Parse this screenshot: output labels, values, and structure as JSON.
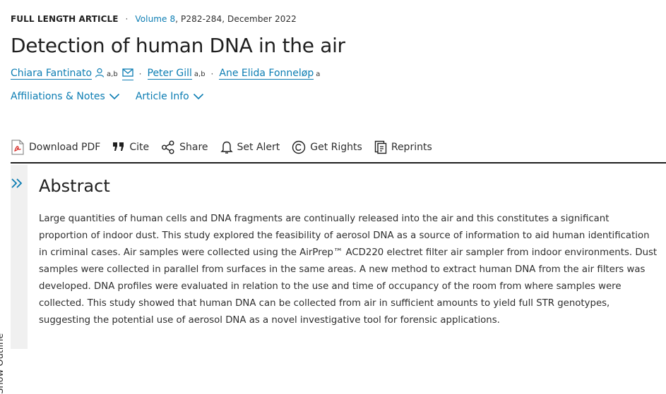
{
  "article": {
    "type": "FULL LENGTH ARTICLE",
    "volume": "Volume 8",
    "pages_date": ", P282-284, December 2022",
    "title": "Detection of human DNA in the air"
  },
  "authors": [
    {
      "name": "Chiara Fantinato",
      "sup": "a,b"
    },
    {
      "name": "Peter Gill",
      "sup": "a,b"
    },
    {
      "name": "Ane Elida Fonneløp",
      "sup": "a"
    }
  ],
  "links": {
    "affiliations": "Affiliations & Notes",
    "article_info": "Article Info"
  },
  "toolbar": {
    "download_pdf": "Download PDF",
    "cite": "Cite",
    "share": "Share",
    "set_alert": "Set Alert",
    "get_rights": "Get Rights",
    "reprints": "Reprints"
  },
  "sidebar": {
    "show_outline": "Show Outline"
  },
  "abstract": {
    "heading": "Abstract",
    "text": "Large quantities of human cells and DNA fragments are continually released into the air and this constitutes a significant proportion of indoor dust. This study explored the feasibility of aerosol DNA as a source of information to aid human identification in criminal cases. Air samples were collected using the AirPrep™ ACD220 electret filter air sampler from indoor environments. Dust samples were collected in parallel from surfaces in the same areas. A new method to extract human DNA from the air filters was developed. DNA profiles were evaluated in relation to the use and time of occupancy of the room from where samples were collected. This study showed that human DNA can be collected from air in sufficient amounts to yield full STR genotypes, suggesting the potential use of aerosol DNA as a novel investigative tool for forensic applications."
  },
  "colors": {
    "link": "#0c7db3",
    "text": "#2e2e2e",
    "pdf_red": "#d9302c",
    "sidebar_bg": "#f0f0f0"
  }
}
